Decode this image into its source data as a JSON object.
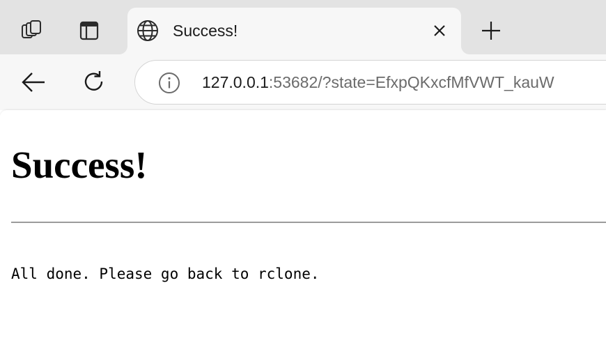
{
  "browser": {
    "tab": {
      "title": "Success!"
    },
    "address_bar": {
      "url_host": "127.0.0.1",
      "url_rest": ":53682/?state=EfxpQKxcfMfVWT_kauW"
    },
    "icons": {
      "workspaces": "workspaces-icon",
      "tab_actions": "tab-actions-icon",
      "favicon": "globe-icon",
      "close": "close-icon",
      "new_tab": "plus-icon",
      "back": "back-arrow-icon",
      "refresh": "refresh-icon",
      "site_info": "info-icon"
    }
  },
  "page": {
    "heading": "Success!",
    "message": "All done. Please go back to rclone."
  },
  "colors": {
    "tabstrip_bg": "#e3e3e3",
    "toolbar_bg": "#f7f7f7",
    "url_host": "#1b1b1b",
    "url_rest": "#6b6b6b",
    "rule": "#9b9b9b"
  }
}
